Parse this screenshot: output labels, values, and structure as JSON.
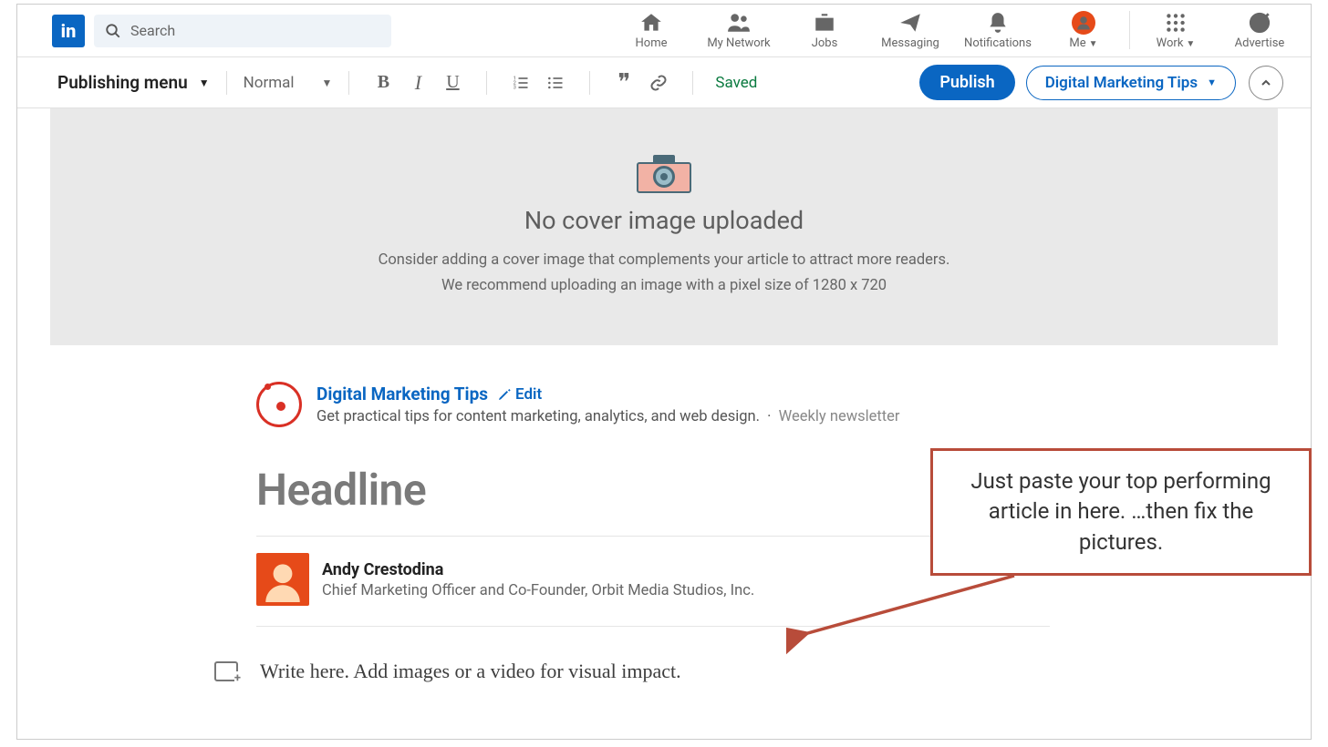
{
  "nav": {
    "logo": "in",
    "search_placeholder": "Search",
    "home": "Home",
    "network": "My Network",
    "jobs": "Jobs",
    "messaging": "Messaging",
    "notifications": "Notifications",
    "me": "Me",
    "work": "Work",
    "advertise": "Advertise"
  },
  "toolbar": {
    "publishing_menu": "Publishing menu",
    "style": "Normal",
    "saved": "Saved",
    "publish": "Publish",
    "newsletter_dropdown": "Digital Marketing Tips"
  },
  "cover": {
    "title": "No cover image uploaded",
    "line1": "Consider adding a cover image that complements your article to attract more readers.",
    "line2": "We recommend uploading an image with a pixel size of 1280 x 720"
  },
  "newsletter": {
    "name": "Digital Marketing Tips",
    "edit_label": "Edit",
    "description": "Get practical tips for content marketing, analytics, and web design.",
    "cadence": "Weekly newsletter"
  },
  "article": {
    "headline_placeholder": "Headline",
    "body_placeholder": "Write here. Add images or a video for visual impact."
  },
  "author": {
    "name": "Andy Crestodina",
    "title": "Chief Marketing Officer and Co-Founder, Orbit Media Studios, Inc."
  },
  "annotation": {
    "text": "Just paste your top performing article in here. …then fix the pictures."
  }
}
